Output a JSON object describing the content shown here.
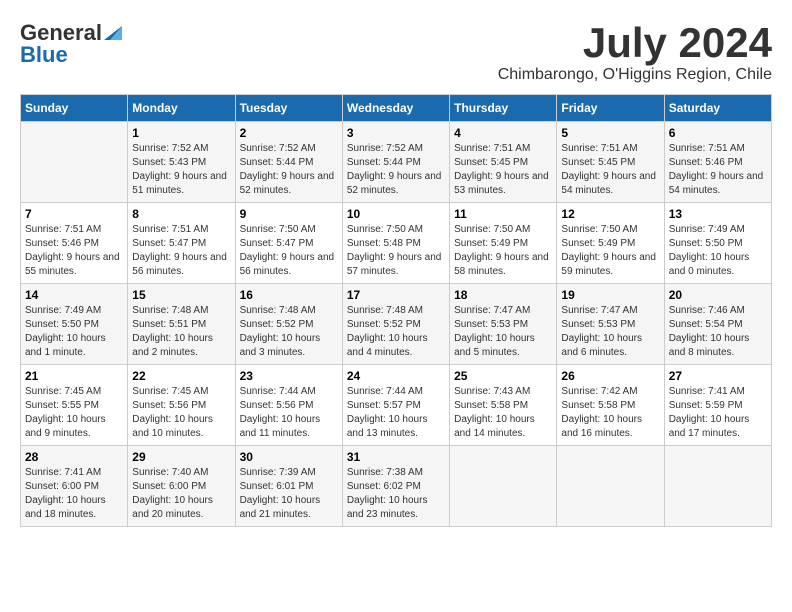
{
  "header": {
    "logo_general": "General",
    "logo_blue": "Blue",
    "month_title": "July 2024",
    "location": "Chimbarongo, O'Higgins Region, Chile"
  },
  "columns": [
    "Sunday",
    "Monday",
    "Tuesday",
    "Wednesday",
    "Thursday",
    "Friday",
    "Saturday"
  ],
  "weeks": [
    [
      {
        "day": "",
        "sunrise": "",
        "sunset": "",
        "daylight": ""
      },
      {
        "day": "1",
        "sunrise": "Sunrise: 7:52 AM",
        "sunset": "Sunset: 5:43 PM",
        "daylight": "Daylight: 9 hours and 51 minutes."
      },
      {
        "day": "2",
        "sunrise": "Sunrise: 7:52 AM",
        "sunset": "Sunset: 5:44 PM",
        "daylight": "Daylight: 9 hours and 52 minutes."
      },
      {
        "day": "3",
        "sunrise": "Sunrise: 7:52 AM",
        "sunset": "Sunset: 5:44 PM",
        "daylight": "Daylight: 9 hours and 52 minutes."
      },
      {
        "day": "4",
        "sunrise": "Sunrise: 7:51 AM",
        "sunset": "Sunset: 5:45 PM",
        "daylight": "Daylight: 9 hours and 53 minutes."
      },
      {
        "day": "5",
        "sunrise": "Sunrise: 7:51 AM",
        "sunset": "Sunset: 5:45 PM",
        "daylight": "Daylight: 9 hours and 54 minutes."
      },
      {
        "day": "6",
        "sunrise": "Sunrise: 7:51 AM",
        "sunset": "Sunset: 5:46 PM",
        "daylight": "Daylight: 9 hours and 54 minutes."
      }
    ],
    [
      {
        "day": "7",
        "sunrise": "Sunrise: 7:51 AM",
        "sunset": "Sunset: 5:46 PM",
        "daylight": "Daylight: 9 hours and 55 minutes."
      },
      {
        "day": "8",
        "sunrise": "Sunrise: 7:51 AM",
        "sunset": "Sunset: 5:47 PM",
        "daylight": "Daylight: 9 hours and 56 minutes."
      },
      {
        "day": "9",
        "sunrise": "Sunrise: 7:50 AM",
        "sunset": "Sunset: 5:47 PM",
        "daylight": "Daylight: 9 hours and 56 minutes."
      },
      {
        "day": "10",
        "sunrise": "Sunrise: 7:50 AM",
        "sunset": "Sunset: 5:48 PM",
        "daylight": "Daylight: 9 hours and 57 minutes."
      },
      {
        "day": "11",
        "sunrise": "Sunrise: 7:50 AM",
        "sunset": "Sunset: 5:49 PM",
        "daylight": "Daylight: 9 hours and 58 minutes."
      },
      {
        "day": "12",
        "sunrise": "Sunrise: 7:50 AM",
        "sunset": "Sunset: 5:49 PM",
        "daylight": "Daylight: 9 hours and 59 minutes."
      },
      {
        "day": "13",
        "sunrise": "Sunrise: 7:49 AM",
        "sunset": "Sunset: 5:50 PM",
        "daylight": "Daylight: 10 hours and 0 minutes."
      }
    ],
    [
      {
        "day": "14",
        "sunrise": "Sunrise: 7:49 AM",
        "sunset": "Sunset: 5:50 PM",
        "daylight": "Daylight: 10 hours and 1 minute."
      },
      {
        "day": "15",
        "sunrise": "Sunrise: 7:48 AM",
        "sunset": "Sunset: 5:51 PM",
        "daylight": "Daylight: 10 hours and 2 minutes."
      },
      {
        "day": "16",
        "sunrise": "Sunrise: 7:48 AM",
        "sunset": "Sunset: 5:52 PM",
        "daylight": "Daylight: 10 hours and 3 minutes."
      },
      {
        "day": "17",
        "sunrise": "Sunrise: 7:48 AM",
        "sunset": "Sunset: 5:52 PM",
        "daylight": "Daylight: 10 hours and 4 minutes."
      },
      {
        "day": "18",
        "sunrise": "Sunrise: 7:47 AM",
        "sunset": "Sunset: 5:53 PM",
        "daylight": "Daylight: 10 hours and 5 minutes."
      },
      {
        "day": "19",
        "sunrise": "Sunrise: 7:47 AM",
        "sunset": "Sunset: 5:53 PM",
        "daylight": "Daylight: 10 hours and 6 minutes."
      },
      {
        "day": "20",
        "sunrise": "Sunrise: 7:46 AM",
        "sunset": "Sunset: 5:54 PM",
        "daylight": "Daylight: 10 hours and 8 minutes."
      }
    ],
    [
      {
        "day": "21",
        "sunrise": "Sunrise: 7:45 AM",
        "sunset": "Sunset: 5:55 PM",
        "daylight": "Daylight: 10 hours and 9 minutes."
      },
      {
        "day": "22",
        "sunrise": "Sunrise: 7:45 AM",
        "sunset": "Sunset: 5:56 PM",
        "daylight": "Daylight: 10 hours and 10 minutes."
      },
      {
        "day": "23",
        "sunrise": "Sunrise: 7:44 AM",
        "sunset": "Sunset: 5:56 PM",
        "daylight": "Daylight: 10 hours and 11 minutes."
      },
      {
        "day": "24",
        "sunrise": "Sunrise: 7:44 AM",
        "sunset": "Sunset: 5:57 PM",
        "daylight": "Daylight: 10 hours and 13 minutes."
      },
      {
        "day": "25",
        "sunrise": "Sunrise: 7:43 AM",
        "sunset": "Sunset: 5:58 PM",
        "daylight": "Daylight: 10 hours and 14 minutes."
      },
      {
        "day": "26",
        "sunrise": "Sunrise: 7:42 AM",
        "sunset": "Sunset: 5:58 PM",
        "daylight": "Daylight: 10 hours and 16 minutes."
      },
      {
        "day": "27",
        "sunrise": "Sunrise: 7:41 AM",
        "sunset": "Sunset: 5:59 PM",
        "daylight": "Daylight: 10 hours and 17 minutes."
      }
    ],
    [
      {
        "day": "28",
        "sunrise": "Sunrise: 7:41 AM",
        "sunset": "Sunset: 6:00 PM",
        "daylight": "Daylight: 10 hours and 18 minutes."
      },
      {
        "day": "29",
        "sunrise": "Sunrise: 7:40 AM",
        "sunset": "Sunset: 6:00 PM",
        "daylight": "Daylight: 10 hours and 20 minutes."
      },
      {
        "day": "30",
        "sunrise": "Sunrise: 7:39 AM",
        "sunset": "Sunset: 6:01 PM",
        "daylight": "Daylight: 10 hours and 21 minutes."
      },
      {
        "day": "31",
        "sunrise": "Sunrise: 7:38 AM",
        "sunset": "Sunset: 6:02 PM",
        "daylight": "Daylight: 10 hours and 23 minutes."
      },
      {
        "day": "",
        "sunrise": "",
        "sunset": "",
        "daylight": ""
      },
      {
        "day": "",
        "sunrise": "",
        "sunset": "",
        "daylight": ""
      },
      {
        "day": "",
        "sunrise": "",
        "sunset": "",
        "daylight": ""
      }
    ]
  ]
}
